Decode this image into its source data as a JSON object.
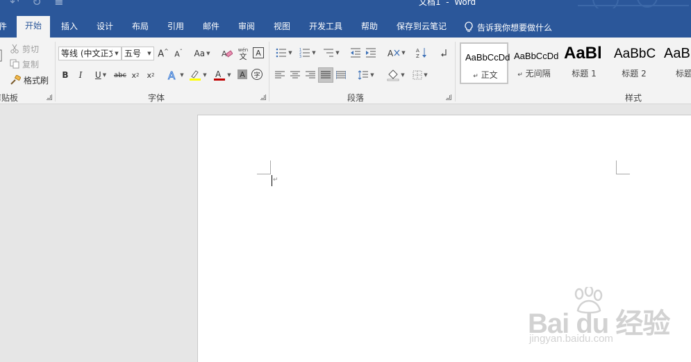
{
  "window": {
    "title": "文档1  -  Word"
  },
  "tabs": [
    {
      "label": "件"
    },
    {
      "label": "开始",
      "active": true
    },
    {
      "label": "插入"
    },
    {
      "label": "设计"
    },
    {
      "label": "布局"
    },
    {
      "label": "引用"
    },
    {
      "label": "邮件"
    },
    {
      "label": "审阅"
    },
    {
      "label": "视图"
    },
    {
      "label": "开发工具"
    },
    {
      "label": "帮助"
    },
    {
      "label": "保存到云笔记"
    }
  ],
  "tell_me": {
    "label": "告诉我你想要做什么",
    "icon": "lightbulb-icon"
  },
  "clipboard": {
    "group_label": "剪贴板",
    "cut_label": "剪切",
    "copy_label": "复制",
    "format_painter_label": "格式刷"
  },
  "font": {
    "group_label": "字体",
    "font_name": "等线 (中文正文)",
    "font_size": "五号",
    "change_case_label": "Aa",
    "bold": "B",
    "italic": "I",
    "underline": "U",
    "strikethrough": "abc",
    "subscript_base": "x",
    "subscript_mark": "2",
    "superscript_base": "x",
    "superscript_mark": "2",
    "font_color": "#c00000",
    "highlight_color": "#ffff00",
    "phonetic_top": "wén",
    "phonetic_char": "文",
    "char_border": "A",
    "char_shading": "A",
    "enclose_char": "字"
  },
  "paragraph": {
    "group_label": "段落"
  },
  "styles": {
    "group_label": "样式",
    "items": [
      {
        "sample": "AaBbCcDd",
        "name": "正文",
        "mark": "↵",
        "selected": true
      },
      {
        "sample": "AaBbCcDd",
        "name": "无间隔",
        "mark": "↵"
      },
      {
        "sample": "AaBl",
        "name": "标题 1"
      },
      {
        "sample": "AaBbC",
        "name": "标题 2"
      },
      {
        "sample": "AaBl",
        "name": "标题"
      }
    ]
  },
  "document": {
    "paragraph_mark": "↵"
  },
  "watermark": {
    "brand": "Bai du 经验",
    "url": "jingyan.baidu.com"
  }
}
